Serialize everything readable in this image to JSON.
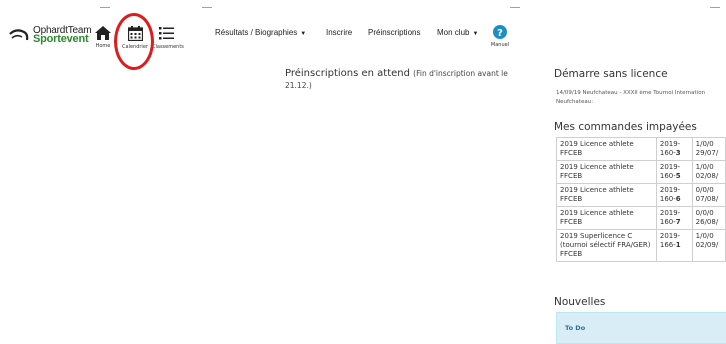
{
  "brand": {
    "line1": "OphardtTeam",
    "line2": "Sportevent"
  },
  "nav_icons": [
    {
      "label": "Home",
      "icon": "home-icon"
    },
    {
      "label": "Calendrier",
      "icon": "calendar-icon"
    },
    {
      "label": "Classements",
      "icon": "list-icon"
    }
  ],
  "menu": {
    "results": "Résultats / Biographies",
    "inscrire": "Inscrire",
    "preinscriptions": "Préinscriptions",
    "monclub": "Mon club",
    "manuel": "Manuel"
  },
  "main": {
    "title": "Préinscriptions en attend",
    "subtitle": "(Fin d'inscription avant le 21.12.)"
  },
  "sidebar": {
    "licence_title": "Démarre sans licence",
    "licence_entry_line1": "14/09/19 Neufchateau - XXXII ème Tournoi Internation",
    "licence_entry_line2": "Neufchateau:",
    "orders_title": "Mes commandes impayées",
    "orders": [
      {
        "name": "2019 Licence athlete FFCEB",
        "ref_prefix": "2019-160-",
        "ref_num": "3",
        "qty": "1/0/0",
        "date": "29/07/"
      },
      {
        "name": "2019 Licence athlete FFCEB",
        "ref_prefix": "2019-160-",
        "ref_num": "5",
        "qty": "1/0/0",
        "date": "02/08/"
      },
      {
        "name": "2019 Licence athlete FFCEB",
        "ref_prefix": "2019-160-",
        "ref_num": "6",
        "qty": "0/0/0",
        "date": "07/08/"
      },
      {
        "name": "2019 Licence athlete FFCEB",
        "ref_prefix": "2019-160-",
        "ref_num": "7",
        "qty": "0/0/0",
        "date": "26/08/"
      },
      {
        "name": "2019 Superlicence C (tournoi sélectif FRA/GER) FFCEB",
        "ref_prefix": "2019-166-",
        "ref_num": "1",
        "qty": "1/0/0",
        "date": "02/09/"
      }
    ],
    "news_title": "Nouvelles",
    "todo_label": "To Do"
  },
  "colors": {
    "brand_green": "#2c8a2c",
    "annotation_red": "#e01b1b",
    "help_blue": "#1e8fc6",
    "todo_bg": "#d9edf7"
  }
}
